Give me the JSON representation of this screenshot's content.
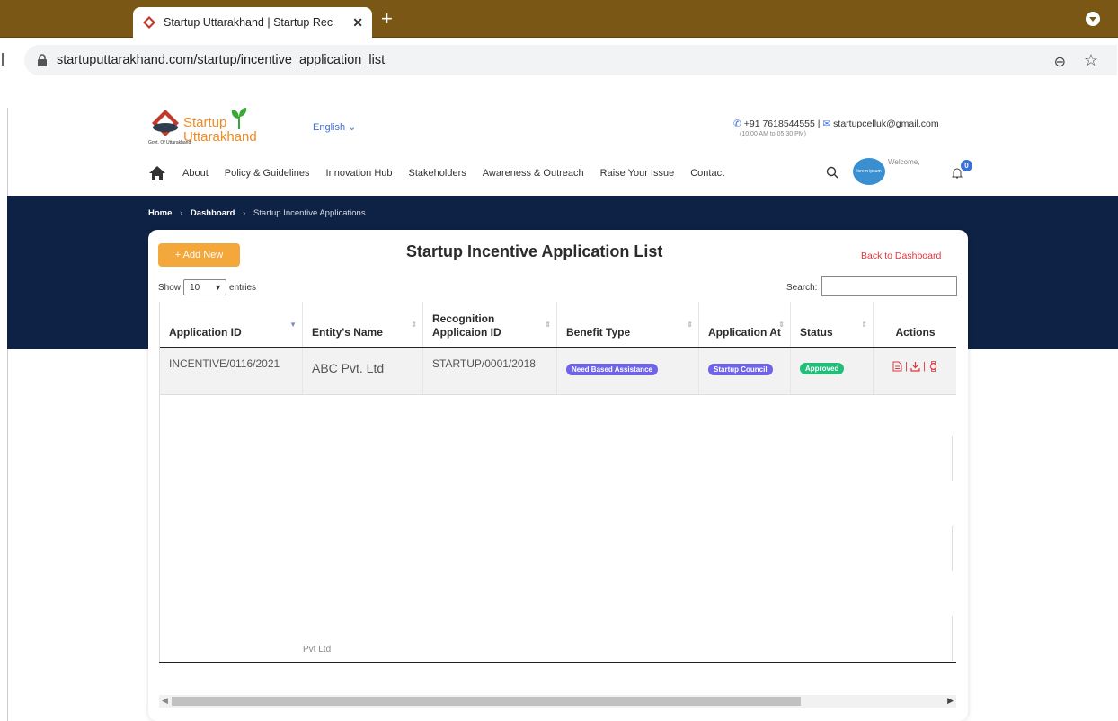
{
  "browser": {
    "tab_title": "Startup Uttarakhand | Startup Rec",
    "new_tab": "+",
    "tab_close": "✕",
    "url": "startuputtarakhand.com/startup/incentive_application_list"
  },
  "header": {
    "logo_line1": "Startup",
    "logo_line2": "Uttarakhand",
    "logo_gov": "Govt. Of Uttarakhand",
    "language": "English ⌄",
    "phone": "+91 7618544555",
    "sep": "|",
    "email": "startupcelluk@gmail.com",
    "hours": "(10:00 AM to 05:30 PM)",
    "nav": [
      "About",
      "Policy & Guidelines",
      "Innovation Hub",
      "Stakeholders",
      "Awareness & Outreach",
      "Raise Your Issue",
      "Contact"
    ],
    "avatar_text": "lorem ipsum",
    "welcome": "Welcome,",
    "notif_count": "0"
  },
  "breadcrumb": {
    "home": "Home",
    "dashboard": "Dashboard",
    "current": "Startup Incentive Applications",
    "sep": "›"
  },
  "card": {
    "add_new": "+  Add New",
    "title": "Startup Incentive Application List",
    "back": "Back to Dashboard",
    "show": "Show",
    "entries_value": "10",
    "entries": "entries",
    "search_label": "Search:"
  },
  "table": {
    "headers": [
      "Application ID",
      "Entity's Name",
      "Recognition Applicaion ID",
      "Benefit Type",
      "Application At",
      "Status",
      "Actions"
    ],
    "rows": [
      {
        "application_id": "INCENTIVE/0116/2021",
        "entity_name": "ABC Pvt. Ltd",
        "recognition_id": "STARTUP/0001/2018",
        "benefit_type": "Need Based Assistance",
        "application_at": "Startup Council",
        "status": "Approved"
      }
    ],
    "ghost": "Pvt Ltd"
  },
  "colors": {
    "brand_orange": "#f4a83c",
    "navy": "#0e2246",
    "badge_purple": "#6f63e8",
    "badge_green": "#1fbf7a",
    "link_red": "#e0363a"
  },
  "icons": [
    "favicon-icon",
    "lock-icon",
    "zoom-icon",
    "star-icon",
    "home-icon",
    "search-icon",
    "bell-icon",
    "view-document-icon",
    "download-icon",
    "watch-icon"
  ]
}
